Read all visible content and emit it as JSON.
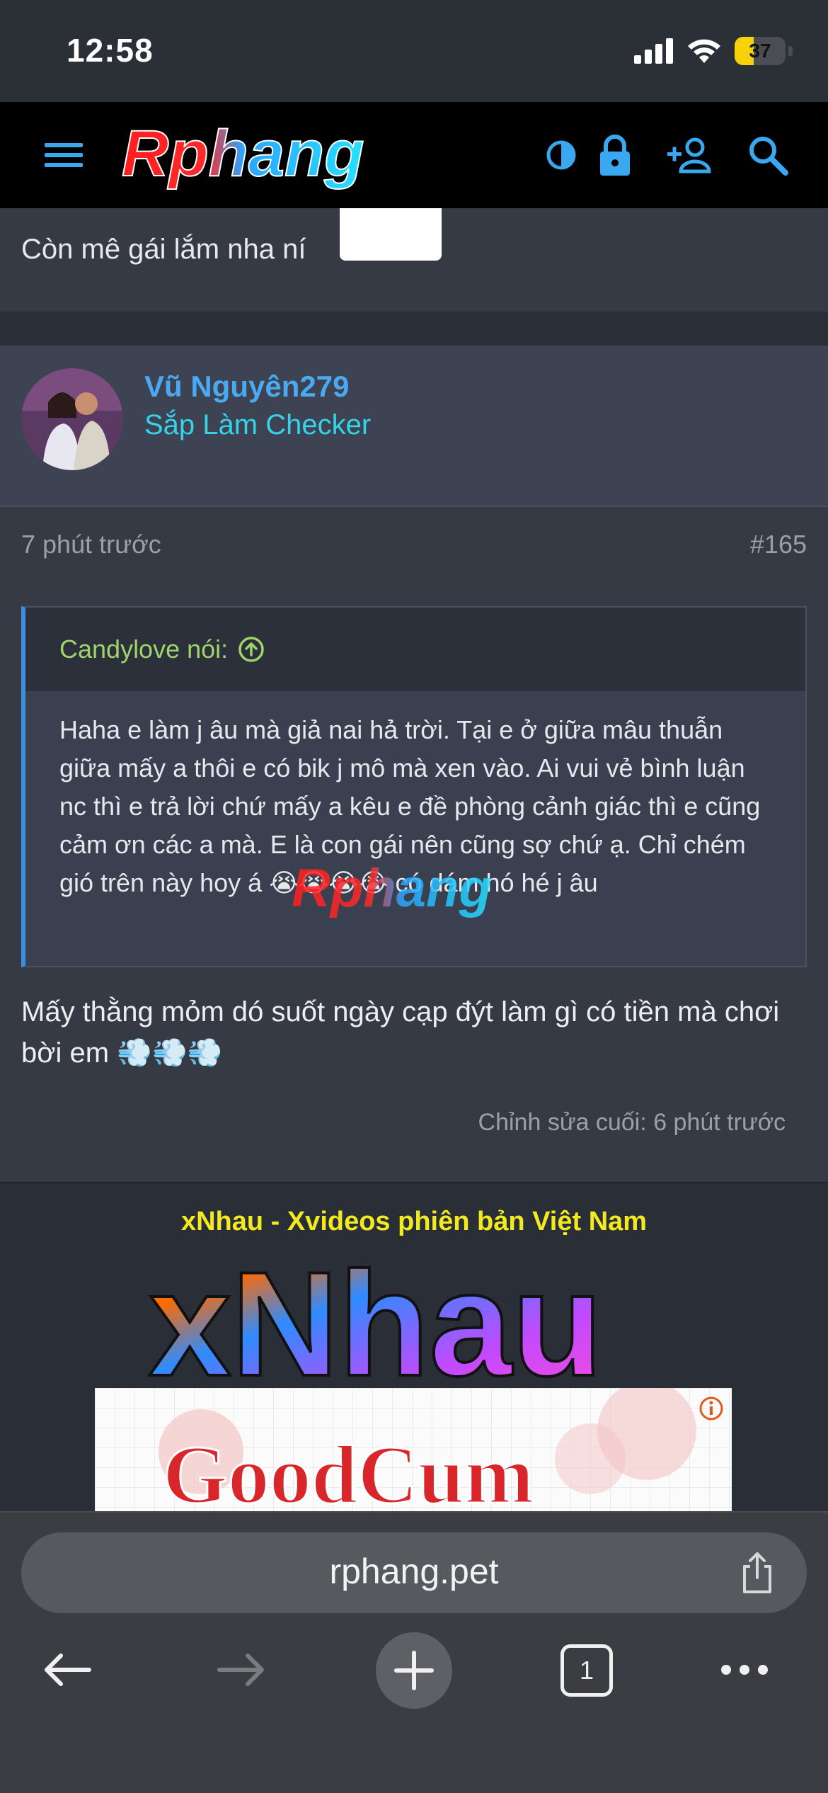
{
  "status_bar": {
    "time": "12:58",
    "battery": "37",
    "battery_level": 0.37
  },
  "header": {
    "logo_text": "Rphang"
  },
  "previous_post": {
    "text": "Còn mê gái lắm nha ní"
  },
  "post": {
    "user_name": "Vũ Nguyên279",
    "user_title": "Sắp Làm Checker",
    "time": "7 phút trước",
    "number": "#165",
    "quote": {
      "author": "Candylove nói:",
      "text": "Haha e làm j âu mà giả nai hả trời. Tại e ở giữa mâu thuẫn giữa mấy a thôi e có bik j mô mà xen vào. Ai vui vẻ bình luận nc thì e trả lời chứ mấy a kêu e đề phòng cảnh giác thì e cũng cảm ơn các a mà. E là con gái nên cũng sợ chứ ạ. Chỉ chém gió trên này hoy á 😭😭😭😭 có dám hó hé j âu",
      "watermark": "Rphang"
    },
    "text": "Mấy thằng mỏm dó suốt ngày cạp đýt làm gì có tiền mà chơi bời em 💨💨💨",
    "edited": "Chỉnh sửa cuối: 6 phút trước"
  },
  "ad": {
    "tagline": "xNhau - Xvideos phiên bản Việt Nam",
    "logo_text": "xNhau",
    "banner_text": "GoodCum"
  },
  "browser": {
    "url": "rphang.pet",
    "tab_count": "1"
  },
  "colors": {
    "accent": "#3b8fe0",
    "username": "#4aa9f0",
    "user_title": "#36d3e8",
    "quote_author": "#9fd46a",
    "ad_tagline": "#f2ea1e"
  }
}
